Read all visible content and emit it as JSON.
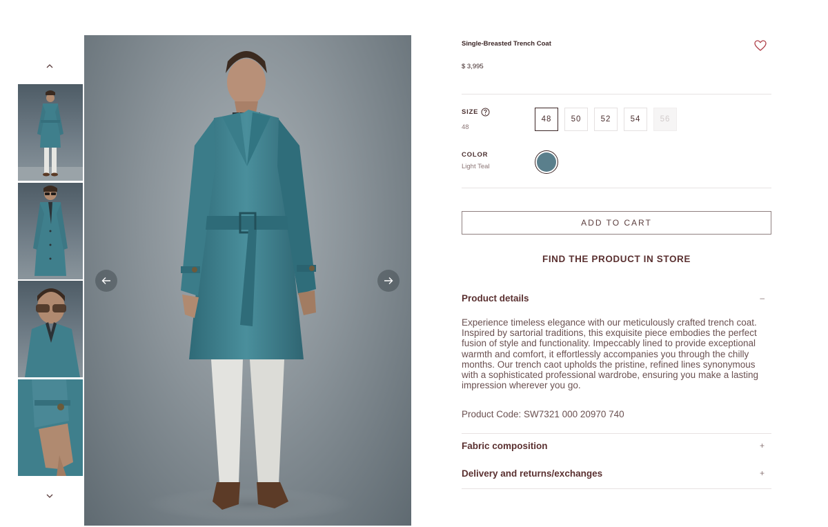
{
  "gallery": {
    "prev_icon": "chevron-up-icon",
    "next_icon": "chevron-down-icon",
    "thumbnails": [
      {
        "alt": "full-length-front"
      },
      {
        "alt": "sunglasses-front"
      },
      {
        "alt": "collar-close-up"
      },
      {
        "alt": "cuff-detail"
      }
    ],
    "arrow_prev_icon": "arrow-left-icon",
    "arrow_next_icon": "arrow-right-icon"
  },
  "product": {
    "title": "Single-Breasted Trench Coat",
    "price": "$ 3,995",
    "wishlist_icon": "heart-icon",
    "size": {
      "label": "SIZE",
      "help_icon": "question-circle-icon",
      "selected": "48",
      "options": [
        {
          "label": "48",
          "state": "selected"
        },
        {
          "label": "50",
          "state": "available"
        },
        {
          "label": "52",
          "state": "available"
        },
        {
          "label": "54",
          "state": "available"
        },
        {
          "label": "56",
          "state": "disabled"
        }
      ]
    },
    "color": {
      "label": "COLOR",
      "selected": "Light Teal",
      "swatch_hex": "#5a7f8c"
    },
    "add_to_cart": "ADD TO CART",
    "find_in_store": "FIND THE PRODUCT IN STORE",
    "details": {
      "heading": "Product details",
      "toggle": "–",
      "description": "Experience timeless elegance with our meticulously crafted trench coat. Inspired by sartorial traditions, this exquisite piece embodies the perfect fusion of style and functionality. Impeccably lined to provide exceptional warmth and comfort, it effortlessly accompanies you through the chilly months. Our trench caot upholds the pristine, refined lines synonymous with a sophisticated professional wardrobe, ensuring you make a lasting impression wherever you go.",
      "product_code": "Product Code: SW7321 000 20970 740"
    },
    "fabric": {
      "heading": "Fabric composition",
      "toggle": "+"
    },
    "delivery": {
      "heading": "Delivery and returns/exchanges",
      "toggle": "+"
    }
  },
  "colors": {
    "text": "#5a3c3c",
    "accent_heart": "#b0414a",
    "coat": "#3f7f8c",
    "background_photo": "#8a9399"
  }
}
